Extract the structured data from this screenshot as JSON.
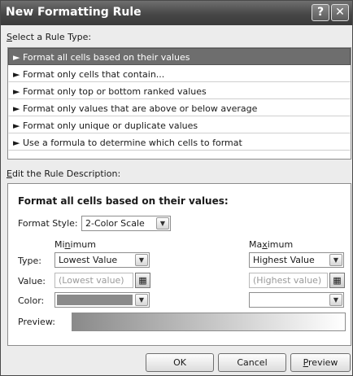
{
  "window": {
    "title": "New Formatting Rule",
    "help_glyph": "?",
    "close_glyph": "✕"
  },
  "rule_type": {
    "label_prefix": "S",
    "label_rest": "elect a Rule Type:",
    "items": [
      {
        "label": "► Format all cells based on their values",
        "selected": true
      },
      {
        "label": "► Format only cells that contain...",
        "selected": false
      },
      {
        "label": "► Format only top or bottom ranked values",
        "selected": false
      },
      {
        "label": "► Format only values that are above or below average",
        "selected": false
      },
      {
        "label": "► Format only unique or duplicate values",
        "selected": false
      },
      {
        "label": "► Use a formula to determine which cells to format",
        "selected": false
      }
    ]
  },
  "description": {
    "label_prefix": "E",
    "label_rest": "dit the Rule Description:",
    "heading": "Format all cells based on their values:",
    "format_style_label": "Format Style:",
    "format_style_value": "2-Color Scale",
    "minimum": {
      "header_pre": "Mi",
      "header_key": "n",
      "header_post": "imum",
      "type_value": "Lowest Value",
      "value_placeholder": "(Lowest value)",
      "color": "#8a8a8a"
    },
    "maximum": {
      "header_pre": "Ma",
      "header_key": "x",
      "header_post": "imum",
      "type_value": "Highest Value",
      "value_placeholder": "(Highest value)",
      "color": "#ffffff"
    },
    "type_label": "Type:",
    "value_label": "Value:",
    "color_label": "Color:",
    "preview_label": "Preview:",
    "preview_gradient": [
      "#8a8a8a",
      "#ffffff"
    ]
  },
  "buttons": {
    "ok": "OK",
    "cancel": "Cancel",
    "preview_key": "P",
    "preview_rest": "review"
  },
  "icons": {
    "dropdown": "chevron-down-icon",
    "range_picker": "collapse-dialog-icon"
  }
}
